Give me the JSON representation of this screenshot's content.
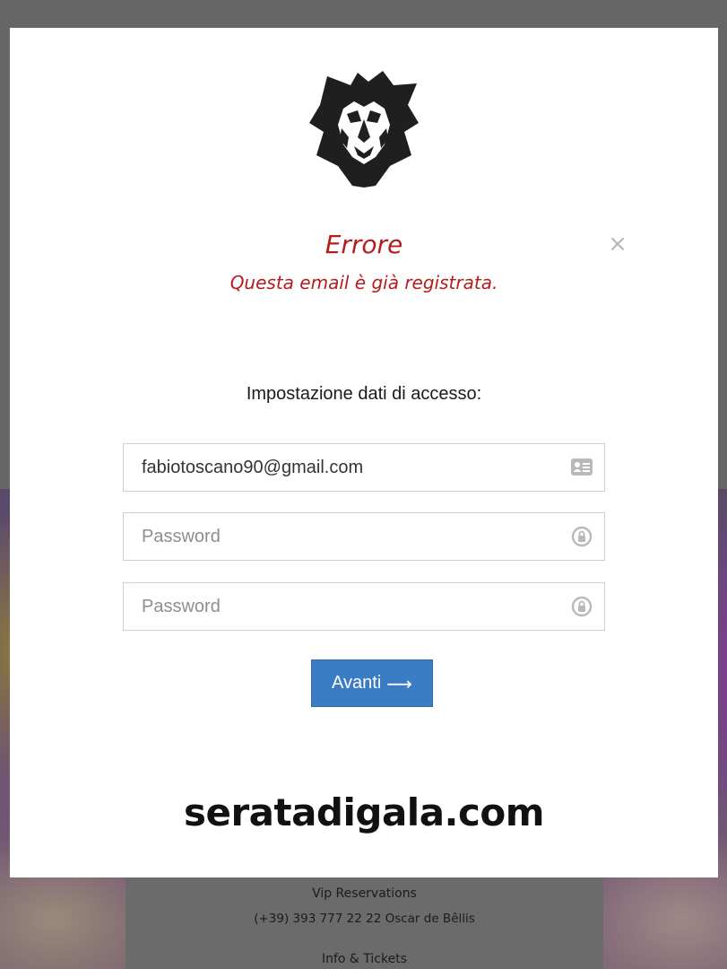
{
  "background": {
    "footer": {
      "vip_label": "Vip Reservations",
      "vip_contact": "(+39) 393 777 22 22  Oscar de Bêllis",
      "info_label": "Info & Tickets"
    }
  },
  "modal": {
    "logo_icon": "lion-head-icon",
    "close_icon": "close-icon",
    "close_glyph": "×",
    "error_title": "Errore",
    "error_message": "Questa email è già registrata.",
    "section_label": "Impostazione dati di accesso:",
    "fields": [
      {
        "value": "fabiotoscano90@gmail.com",
        "placeholder": "",
        "icon": "contact-card-icon"
      },
      {
        "value": "",
        "placeholder": "Password",
        "icon": "lock-icon"
      },
      {
        "value": "",
        "placeholder": "Password",
        "icon": "lock-icon"
      }
    ],
    "next_button": {
      "label": "Avanti",
      "arrow": "⟶"
    },
    "brand": "seratadigala.com"
  },
  "colors": {
    "error": "#b71c1c",
    "button": "#3b7dc4",
    "overlay": "#666666"
  }
}
